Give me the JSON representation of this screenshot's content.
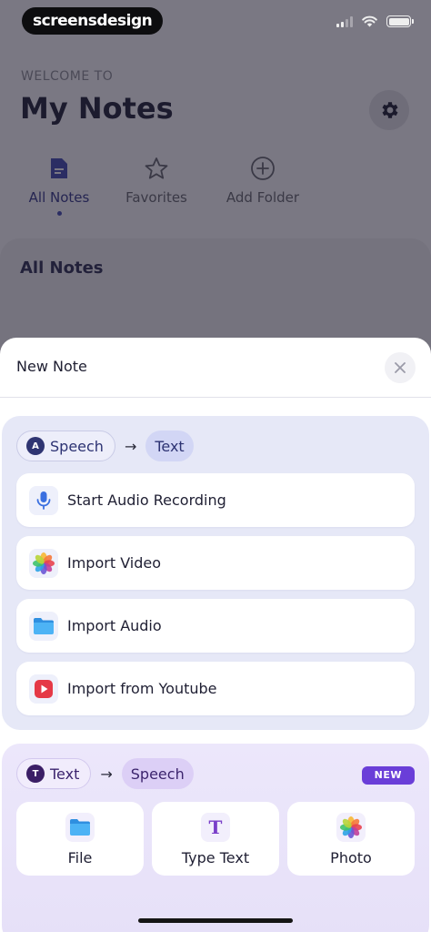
{
  "status_bar": {
    "brand": "screensdesign"
  },
  "header": {
    "welcome": "WELCOME TO",
    "title": "My Notes",
    "settings_icon": "gear-icon"
  },
  "tabs": [
    {
      "label": "All Notes",
      "icon": "note-icon",
      "active": true
    },
    {
      "label": "Favorites",
      "icon": "star-icon",
      "active": false
    },
    {
      "label": "Add Folder",
      "icon": "plus-circle-icon",
      "active": false
    }
  ],
  "list": {
    "title": "All Notes"
  },
  "sheet": {
    "title": "New Note",
    "close_icon": "close-icon",
    "speech_to_text": {
      "from_label": "Speech",
      "to_label": "Text",
      "items": [
        {
          "label": "Start Audio Recording",
          "icon": "microphone-icon"
        },
        {
          "label": "Import Video",
          "icon": "photos-icon"
        },
        {
          "label": "Import Audio",
          "icon": "folder-icon"
        },
        {
          "label": "Import from Youtube",
          "icon": "youtube-icon"
        }
      ]
    },
    "text_to_speech": {
      "from_label": "Text",
      "to_label": "Speech",
      "badge": "NEW",
      "tiles": [
        {
          "label": "File",
          "icon": "folder-icon"
        },
        {
          "label": "Type Text",
          "icon": "text-t-icon",
          "glyph": "T"
        },
        {
          "label": "Photo",
          "icon": "photos-icon"
        }
      ]
    }
  },
  "colors": {
    "accent": "#6a3ed8",
    "navy": "#2f3572",
    "purple": "#3b1e66",
    "youtube_red": "#e53946",
    "folder_blue": "#3ea3ee"
  }
}
